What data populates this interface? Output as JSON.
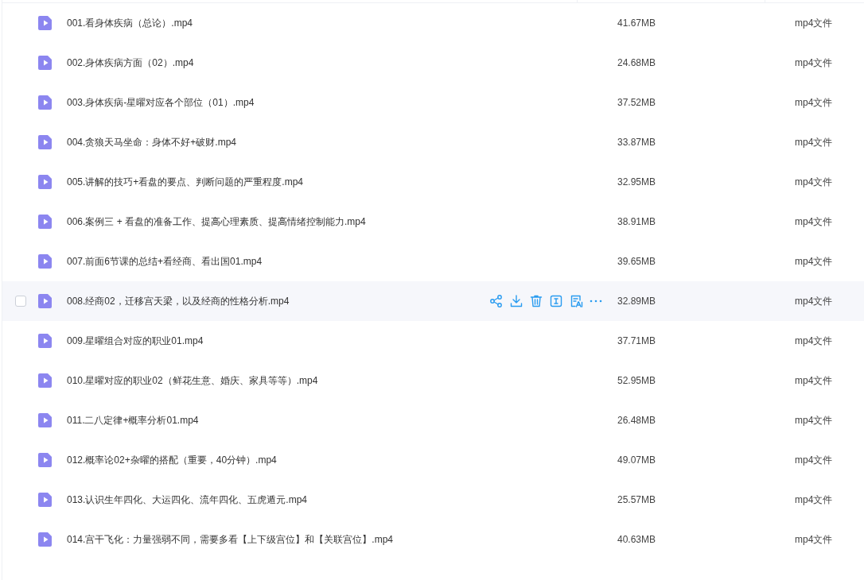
{
  "files": [
    {
      "name": "001.看身体疾病（总论）.mp4",
      "size": "41.67MB",
      "type": "mp4文件",
      "hovered": false
    },
    {
      "name": "002.身体疾病方面（02）.mp4",
      "size": "24.68MB",
      "type": "mp4文件",
      "hovered": false
    },
    {
      "name": "003.身体疾病-星曜对应各个部位（01）.mp4",
      "size": "37.52MB",
      "type": "mp4文件",
      "hovered": false
    },
    {
      "name": "004.贪狼天马坐命：身体不好+破财.mp4",
      "size": "33.87MB",
      "type": "mp4文件",
      "hovered": false
    },
    {
      "name": "005.讲解的技巧+看盘的要点、判断问题的严重程度.mp4",
      "size": "32.95MB",
      "type": "mp4文件",
      "hovered": false
    },
    {
      "name": "006.案例三 + 看盘的准备工作、提高心理素质、提高情绪控制能力.mp4",
      "size": "38.91MB",
      "type": "mp4文件",
      "hovered": false
    },
    {
      "name": "007.前面6节课的总结+看经商、看出国01.mp4",
      "size": "39.65MB",
      "type": "mp4文件",
      "hovered": false
    },
    {
      "name": "008.经商02，迁移宫天梁，以及经商的性格分析.mp4",
      "size": "32.89MB",
      "type": "mp4文件",
      "hovered": true
    },
    {
      "name": "009.星曜组合对应的职业01.mp4",
      "size": "37.71MB",
      "type": "mp4文件",
      "hovered": false
    },
    {
      "name": "010.星曜对应的职业02（鲜花生意、婚庆、家具等等）.mp4",
      "size": "52.95MB",
      "type": "mp4文件",
      "hovered": false
    },
    {
      "name": "011.二八定律+概率分析01.mp4",
      "size": "26.48MB",
      "type": "mp4文件",
      "hovered": false
    },
    {
      "name": "012.概率论02+杂曜的搭配（重要，40分钟）.mp4",
      "size": "49.07MB",
      "type": "mp4文件",
      "hovered": false
    },
    {
      "name": "013.认识生年四化、大运四化、流年四化、五虎遁元.mp4",
      "size": "25.57MB",
      "type": "mp4文件",
      "hovered": false
    },
    {
      "name": "014.宫干飞化：力量强弱不同，需要多看【上下级宫位】和【关联宫位】.mp4",
      "size": "40.63MB",
      "type": "mp4文件",
      "hovered": false
    }
  ]
}
